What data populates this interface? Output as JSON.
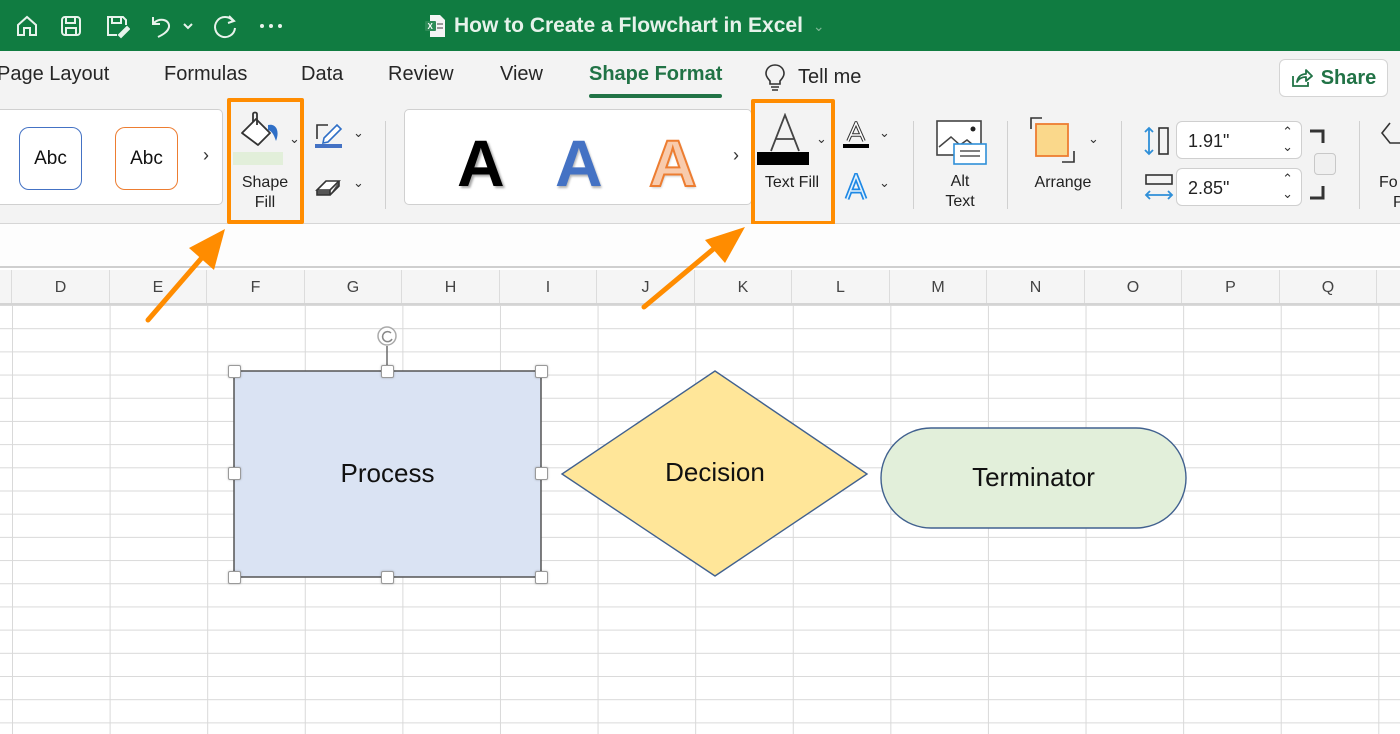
{
  "titlebar": {
    "icons": [
      "home-icon",
      "save-icon",
      "save-as-icon",
      "undo-icon",
      "undo-dropdown-icon",
      "redo-icon",
      "more-icon"
    ],
    "document_title": "How to Create a Flowchart in Excel",
    "colors": {
      "background": "#107c41"
    }
  },
  "tabs": {
    "items": [
      {
        "label": "Page Layout",
        "active": false
      },
      {
        "label": "Formulas",
        "active": false
      },
      {
        "label": "Data",
        "active": false
      },
      {
        "label": "Review",
        "active": false
      },
      {
        "label": "View",
        "active": false
      },
      {
        "label": "Shape Format",
        "active": true
      }
    ],
    "tell_me": "Tell me",
    "share_label": "Share",
    "accent_color": "#217346"
  },
  "ribbon": {
    "shape_styles": [
      {
        "label": "Abc",
        "border": "#4472c4"
      },
      {
        "label": "Abc",
        "border": "#ed7d31"
      }
    ],
    "shape_fill": {
      "label_line1": "Shape",
      "label_line2": "Fill",
      "swatch": "#e2efda"
    },
    "shape_outline_color": "#4472c4",
    "wordart_styles": [
      {
        "label": "A",
        "color": "#000000"
      },
      {
        "label": "A",
        "color": "#4472c4"
      },
      {
        "label": "A",
        "color": "#f8cbad"
      }
    ],
    "text_fill": {
      "label": "Text Fill",
      "swatch": "#000000"
    },
    "alt_text": {
      "label_line1": "Alt",
      "label_line2": "Text"
    },
    "arrange": {
      "label": "Arrange"
    },
    "height_value": "1.91\"",
    "width_value": "2.85\"",
    "format_pane": {
      "label_line1": "Fo",
      "label_line2": "P"
    },
    "highlight_color": "#ff8c00"
  },
  "sheet": {
    "columns": [
      "D",
      "E",
      "F",
      "G",
      "H",
      "I",
      "J",
      "K",
      "L",
      "M",
      "N",
      "O",
      "P",
      "Q"
    ]
  },
  "shapes": {
    "process": {
      "label": "Process",
      "fill": "#dae3f3",
      "selected": true
    },
    "decision": {
      "label": "Decision",
      "fill": "#ffe699"
    },
    "terminator": {
      "label": "Terminator",
      "fill": "#e2efda"
    }
  }
}
